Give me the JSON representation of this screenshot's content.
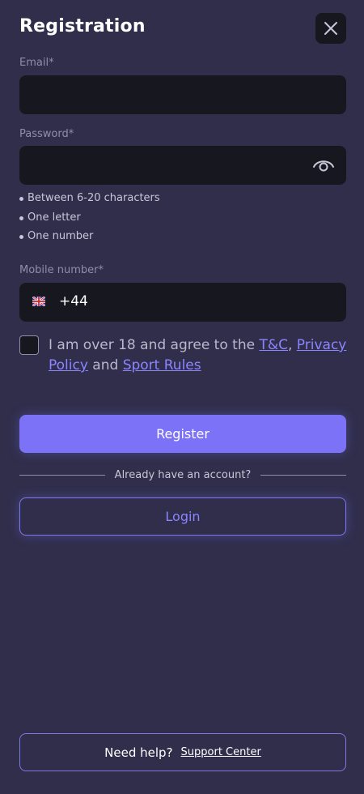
{
  "header": {
    "title": "Registration",
    "close_icon": "close-icon"
  },
  "email": {
    "label": "Email*",
    "value": "",
    "placeholder": ""
  },
  "password": {
    "label": "Password*",
    "value": "",
    "placeholder": "",
    "toggle_icon": "eye-icon",
    "rules": [
      "Between 6-20 characters",
      "One letter",
      "One number"
    ]
  },
  "mobile": {
    "label": "Mobile number*",
    "flag_icon": "uk-flag-icon",
    "prefix": "+44",
    "value": ""
  },
  "consent": {
    "checked": false,
    "text_before": "I am over 18 and agree to the ",
    "tc_link": "T&C",
    "comma": ", ",
    "privacy_link": "Privacy Policy",
    "and": " and ",
    "sport_rules_link": "Sport Rules"
  },
  "actions": {
    "register_label": "Register",
    "divider_text": "Already have an account?",
    "login_label": "Login"
  },
  "help": {
    "text": "Need help?",
    "support_link": "Support Center"
  },
  "colors": {
    "background": "#302e4b",
    "input_bg": "#17181f",
    "accent": "#7b72f8",
    "link": "#8b85ff"
  }
}
